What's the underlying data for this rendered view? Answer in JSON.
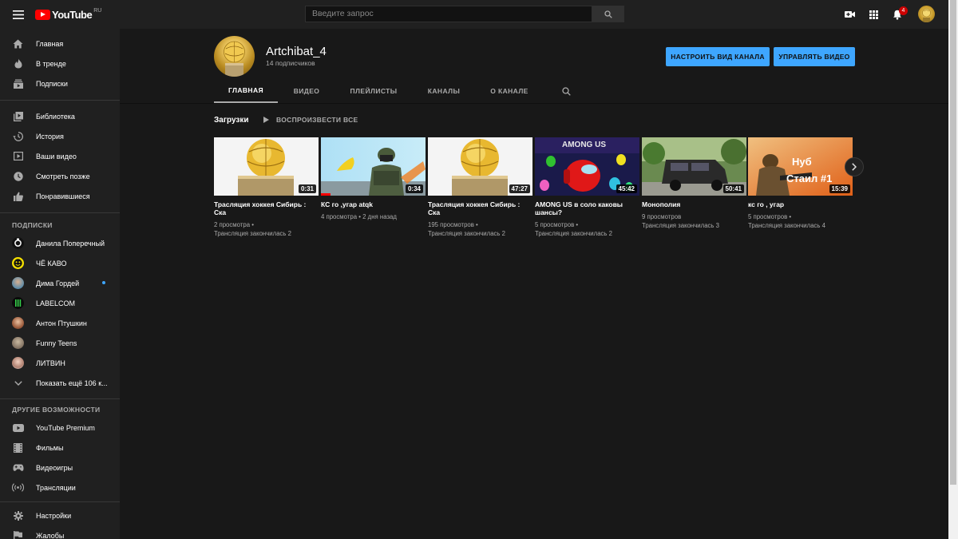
{
  "header": {
    "logo_text": "YouTube",
    "logo_region": "RU",
    "search_placeholder": "Введите запрос",
    "notification_count": "4"
  },
  "sidebar": {
    "main": [
      {
        "label": "Главная",
        "icon": "home-icon"
      },
      {
        "label": "В тренде",
        "icon": "fire-icon"
      },
      {
        "label": "Подписки",
        "icon": "subscriptions-icon"
      }
    ],
    "library": [
      {
        "label": "Библиотека",
        "icon": "library-icon"
      },
      {
        "label": "История",
        "icon": "history-icon"
      },
      {
        "label": "Ваши видео",
        "icon": "your-videos-icon"
      },
      {
        "label": "Смотреть позже",
        "icon": "clock-icon"
      },
      {
        "label": "Понравившиеся",
        "icon": "thumbs-up-icon"
      }
    ],
    "subscriptions_heading": "ПОДПИСКИ",
    "subscriptions": [
      {
        "label": "Данила Поперечный"
      },
      {
        "label": "ЧЁ КАВО"
      },
      {
        "label": "Дима Гордей"
      },
      {
        "label": "LABELCOM"
      },
      {
        "label": "Антон Птушкин"
      },
      {
        "label": "Funny Teens"
      },
      {
        "label": "ЛИТВИН"
      }
    ],
    "show_more": "Показать ещё 106 к...",
    "other_heading": "ДРУГИЕ ВОЗМОЖНОСТИ",
    "other": [
      {
        "label": "YouTube Premium",
        "icon": "youtube-icon"
      },
      {
        "label": "Фильмы",
        "icon": "film-icon"
      },
      {
        "label": "Видеоигры",
        "icon": "gamepad-icon"
      },
      {
        "label": "Трансляции",
        "icon": "broadcast-icon"
      }
    ],
    "bottom": [
      {
        "label": "Настройки",
        "icon": "gear-icon"
      },
      {
        "label": "Жалобы",
        "icon": "flag-icon"
      }
    ]
  },
  "channel": {
    "name": "Artchibat_4",
    "subscribers": "14 подписчиков",
    "customize_button": "НАСТРОИТЬ ВИД КАНАЛА",
    "manage_button": "УПРАВЛЯТЬ ВИДЕО",
    "tabs": [
      "ГЛАВНАЯ",
      "ВИДЕО",
      "ПЛЕЙЛИСТЫ",
      "КАНАЛЫ",
      "О КАНАЛЕ"
    ],
    "active_tab": 0
  },
  "shelf": {
    "title": "Загрузки",
    "play_all": "ВОСПРОИЗВЕСТИ ВСЕ",
    "videos": [
      {
        "title": "Трасляция хоккея Сибирь : Ска",
        "duration": "0:31",
        "views": "2 просмотра",
        "date": "Трансляция закончилась 2"
      },
      {
        "title": "КС го ,угар atqk",
        "duration": "0:34",
        "views": "4 просмотра",
        "date": "2 дня назад"
      },
      {
        "title": "Трасляция хоккея Сибирь : Ска",
        "duration": "47:27",
        "views": "195 просмотров",
        "date": "Трансляция закончилась 2"
      },
      {
        "title": "AMONG US в соло каковы шансы?",
        "duration": "45:42",
        "views": "5 просмотров",
        "date": "Трансляция закончилась 2",
        "thumb_text": "AMONG US"
      },
      {
        "title": "Монополия",
        "duration": "50:41",
        "views": "9 просмотров",
        "date": "Трансляция закончилась 3"
      },
      {
        "title": "кс го , угар",
        "duration": "15:39",
        "views": "5 просмотров",
        "date": "Трансляция закончилась 4",
        "thumb_text_1": "Нуб",
        "thumb_text_2": "Стаил #1"
      }
    ]
  },
  "colors": {
    "accent_blue": "#3ea6ff",
    "brand_red": "#ff0000",
    "bg": "#181818",
    "panel": "#202020"
  }
}
